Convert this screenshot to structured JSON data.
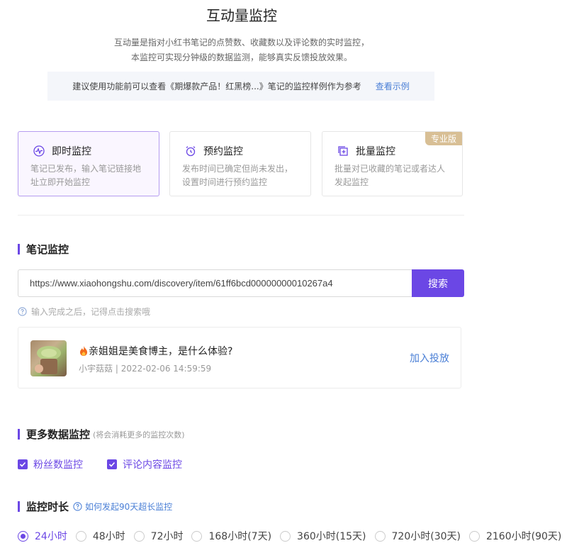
{
  "header": {
    "title": "互动量监控",
    "intro_line1": "互动量是指对小红书笔记的点赞数、收藏数以及评论数的实时监控，",
    "intro_line2": "本监控可实现分钟级的数据监测，能够真实反馈投放效果。",
    "tip_text": "建议使用功能前可以查看《期爆款产品！红黑榜...》笔记的监控样例作为参考",
    "tip_link": "查看示例"
  },
  "modes": [
    {
      "label": "即时监控",
      "desc": "笔记已发布，输入笔记链接地址立即开始监控",
      "icon": "pulse-icon",
      "active": true
    },
    {
      "label": "预约监控",
      "desc": "发布时间已确定但尚未发出，设置时间进行预约监控",
      "icon": "alarm-clock-icon",
      "active": false
    },
    {
      "label": "批量监控",
      "desc": "批量对已收藏的笔记或者达人发起监控",
      "icon": "batch-add-icon",
      "active": false,
      "badge": "专业版"
    }
  ],
  "note_section": {
    "title": "笔记监控",
    "input_value": "https://www.xiaohongshu.com/discovery/item/61ff6bcd00000000010267a4",
    "search_label": "搜索",
    "hint": "输入完成之后，记得点击搜索哦"
  },
  "note_result": {
    "title": "亲姐姐是美食博主，是什么体验?",
    "author": "小宇菇菇",
    "separator": "|",
    "date": "2022-02-06 14:59:59",
    "add_label": "加入投放"
  },
  "more_section": {
    "title": "更多数据监控",
    "subtitle": "(将会消耗更多的监控次数)",
    "options": [
      {
        "label": "粉丝数监控",
        "checked": true
      },
      {
        "label": "评论内容监控",
        "checked": true
      }
    ]
  },
  "duration_section": {
    "title": "监控时长",
    "help": "如何发起90天超长监控",
    "options": [
      "24小时",
      "48小时",
      "72小时",
      "168小时(7天)",
      "360小时(15天)",
      "720小时(30天)",
      "2160小时(90天)"
    ],
    "selected_index": 0
  },
  "colors": {
    "accent": "#6b47e5",
    "link": "#4a7fd6",
    "pro_badge": "#d8bf95"
  }
}
